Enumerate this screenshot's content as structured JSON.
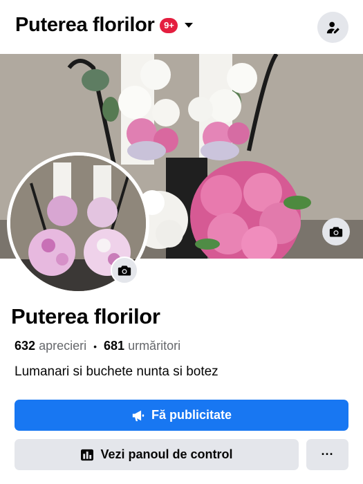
{
  "header": {
    "page_title": "Puterea florilor",
    "notification_badge": "9+",
    "icons": {
      "switcher": "chevron-down-icon",
      "profile": "user-pen-icon"
    }
  },
  "cover": {
    "camera_icon": "camera-icon"
  },
  "avatar": {
    "camera_icon": "camera-icon"
  },
  "profile": {
    "name": "Puterea florilor",
    "likes_count": "632",
    "likes_label": "aprecieri",
    "separator": "•",
    "followers_count": "681",
    "followers_label": "urmăritori",
    "bio": "Lumanari si buchete nunta si botez"
  },
  "actions": {
    "promote_label": "Fă publicitate",
    "dashboard_label": "Vezi panoul de control",
    "more_label": "···"
  },
  "colors": {
    "accent": "#1877f2",
    "badge": "#e41e3f",
    "button_gray": "#e4e6eb",
    "secondary_text": "#65676b"
  }
}
